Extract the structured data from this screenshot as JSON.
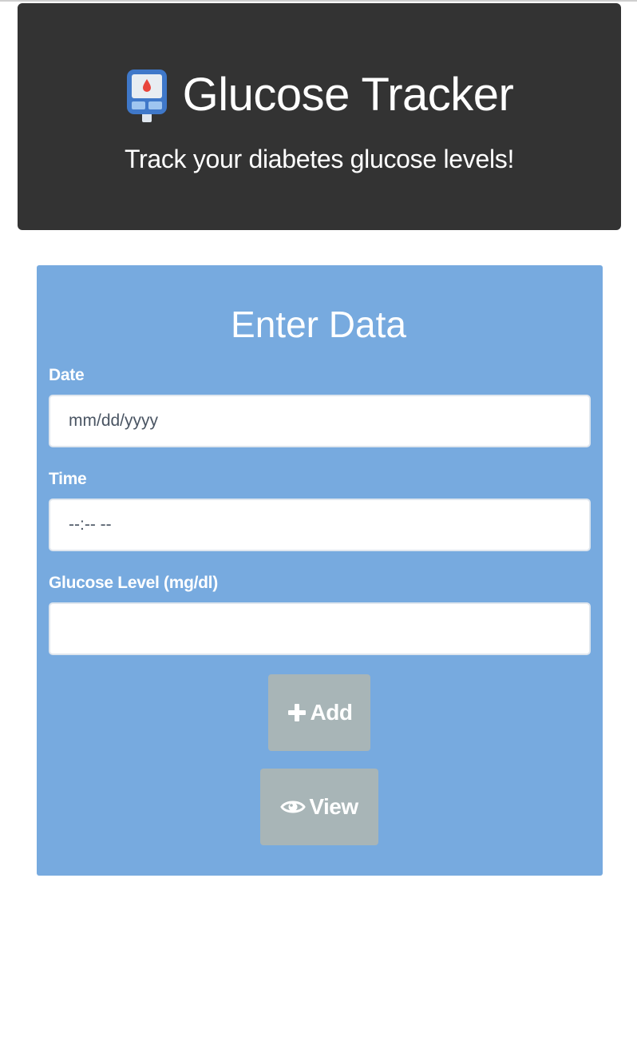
{
  "header": {
    "title": "Glucose Tracker",
    "subtitle": "Track your diabetes glucose levels!",
    "icon": "glucose-meter-icon"
  },
  "form": {
    "title": "Enter Data",
    "date": {
      "label": "Date",
      "placeholder": "mm/dd/yyyy",
      "value": ""
    },
    "time": {
      "label": "Time",
      "placeholder": "--:-- --",
      "value": ""
    },
    "glucose": {
      "label": "Glucose Level (mg/dl)",
      "placeholder": "",
      "value": ""
    },
    "add_button": {
      "label": "Add",
      "icon": "plus-icon"
    },
    "view_button": {
      "label": "View",
      "icon": "eye-icon"
    }
  },
  "colors": {
    "header_bg": "#333333",
    "panel_bg": "#77aadf",
    "button_bg": "#a8b5b7",
    "text_light": "#ffffff"
  }
}
